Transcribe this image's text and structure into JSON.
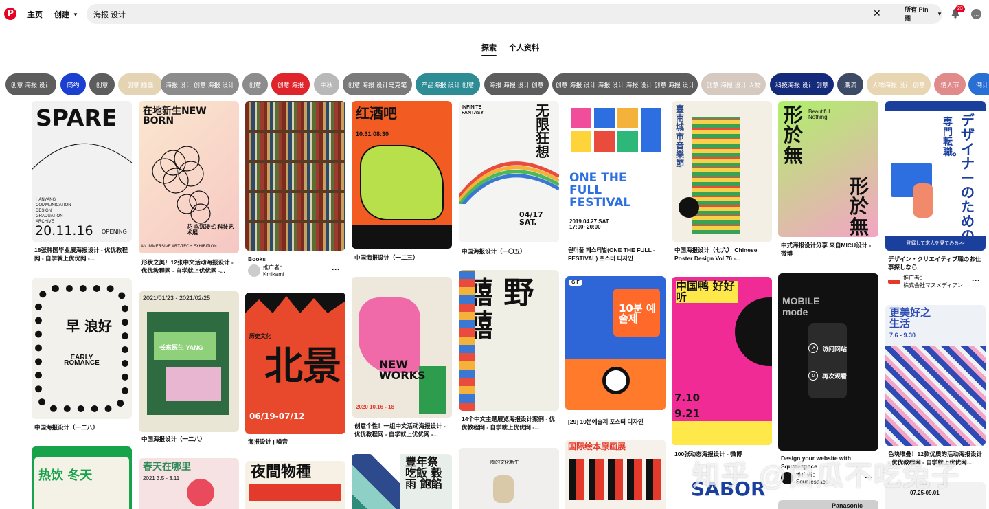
{
  "header": {
    "logo": "P",
    "home": "主页",
    "create": "创建",
    "search_value": "海报 设计",
    "clear_icon": "✕",
    "scope": "所有 Pin 图",
    "notifications_count": "23",
    "chat_icon": "…"
  },
  "tabs": [
    {
      "label": "探索",
      "active": true
    },
    {
      "label": "个人资料",
      "active": false
    }
  ],
  "chips": [
    {
      "label": "创意 海报 设计",
      "color": "#5d5d5d"
    },
    {
      "label": "简约",
      "color": "#1a3fd1"
    },
    {
      "label": "创意",
      "color": "#5d5d5d"
    },
    {
      "label": "创意 插画",
      "color": "#e4d4b4"
    },
    {
      "label": "海报 设计 创意 海报 设计",
      "color": "#8c8c8c"
    },
    {
      "label": "创意",
      "color": "#8c8c8c"
    },
    {
      "label": "创意 海报",
      "color": "#e0242b"
    },
    {
      "label": "中秋",
      "color": "#b8b8b8"
    },
    {
      "label": "创意 海报 设计马克笔",
      "color": "#7a7a7a"
    },
    {
      "label": "产品海报 设计 创意",
      "color": "#2e8c95"
    },
    {
      "label": "海报 海报 设计 创意",
      "color": "#5d5d5d"
    },
    {
      "label": "创意 海报 设计 海报 设计 海报 设计 创意 海报 设计",
      "color": "#5d5d5d"
    },
    {
      "label": "创意 海报 设计 人物",
      "color": "#d6c9c0"
    },
    {
      "label": "科技海报 设计 创意",
      "color": "#142a7a"
    },
    {
      "label": "潮流",
      "color": "#3d4a66"
    },
    {
      "label": "人物海报 设计 创意",
      "color": "#e8d6b2"
    },
    {
      "label": "情人节",
      "color": "#e08a8a"
    },
    {
      "label": "倒计",
      "color": "#2a6fd4"
    }
  ],
  "pins": {
    "p1": {
      "big": "SPARE",
      "sub": "HANYANG COMMUNICATION DESIGN GRADUATION ARCHIVE",
      "date": "20.11.16",
      "tag": "OPENING",
      "caption": "18张韩国毕业展海报设计 - 优优教程网 - 自学就上优优网 -..."
    },
    "p2": {
      "big": "在地新生NEW BORN",
      "sub": "AN IMMERSIVE ART-TECH EXHIBITION",
      "cn": "花 鸟沉浸式 科技艺术展",
      "caption": "形状之美！12张中文活动海报设计 - 优优教程网 - 自学就上优优网 -..."
    },
    "p3": {
      "caption": "Books",
      "promoted": "推广者：",
      "user": "Kmikami"
    },
    "p4": {
      "big": "红酒吧",
      "sub": "10.31  08:30",
      "caption": "中国海报设计（一二三）"
    },
    "p5": {
      "big": "无限狂想",
      "sub": "INFINITE FANTASY",
      "date": "04/17 SAT.",
      "caption": "中国海报设计（一〇五）"
    },
    "p6": {
      "big": "ONE THE FULL FESTIVAL",
      "date": "2019.04.27 SAT 17:00~20:00",
      "caption": "원더풀 페스티벌(ONE THE FULL - FESTIVAL) 포스터 디자인"
    },
    "p7": {
      "big": "臺南城市音樂節",
      "caption": "中国海报设计（七六） Chinese Poster Design Vol.76 -..."
    },
    "p8": {
      "big": "形於無",
      "sub": "Beautiful Nothing",
      "caption": "中式海报设计分享 来自MICU设计 - 微博"
    },
    "p9": {
      "big": "デザイナーのための",
      "sub": "専門転職。",
      "cta": "登録して求人を見てみる>>",
      "caption": "デザイン・クリエイティブ職のお仕事探しなら",
      "promoted": "推广者：",
      "user": "株式会社マスメディアン"
    },
    "p10": {
      "big": "早 浪好",
      "sub": "EARLY ROMANCE",
      "caption": "中国海报设计（一二八）"
    },
    "p11": {
      "big": "2021/01/23 - 2021/02/25",
      "sub": "长东医生 YANG",
      "caption": "中国海报设计（一二八）"
    },
    "p12": {
      "big": "北景",
      "sub": "历史文化",
      "date": "06/19-07/12",
      "caption": "海报设计 | 噪音"
    },
    "p13": {
      "big": "NEW WORKS",
      "date": "2020 10.16 - 18",
      "caption": "创意个性！一组中文活动海报设计 - 优优教程网 - 自学就上优优网 -..."
    },
    "p14": {
      "big": "囍 野 囍",
      "caption": "14个中文主题展览海报设计案例 - 优优教程网 - 自学就上优优网 -..."
    },
    "p15": {
      "big": "10분 예술제",
      "gif": "GIF",
      "caption": "[29] 10분예술제 포스터 디자인"
    },
    "p16": {
      "big": "中国鸭 好好听",
      "date": "7.10 9.21",
      "caption": "100张动态海报设计 - 微博"
    },
    "p17": {
      "sub": "MOBILE mode",
      "visit": "访问网站",
      "replay": "再次观看",
      "caption": "Design your website with Squarespace",
      "promoted": "推广者：",
      "user": "Squarespace"
    },
    "p18": {
      "big": "更美好之生活",
      "date": "7.6 - 9.30",
      "caption": "色块堆叠！12款优质的活动海报设计 - 优优教程网 - 自学就上优优网..."
    },
    "p19": {
      "big": "热饮 冬天",
      "caption": ""
    },
    "p20": {
      "big": "春天在哪里",
      "date": "2021 3.5 - 3.11",
      "caption": ""
    },
    "p21": {
      "big": "夜間物種",
      "caption": ""
    },
    "p22": {
      "big": "豐年祭 吃飯 穀雨 飽餡",
      "caption": ""
    },
    "p23": {
      "big": "陶的文化新生",
      "caption": ""
    },
    "p24": {
      "big": "国际绘本原画展",
      "caption": ""
    },
    "p25": {
      "big": "SABOR",
      "caption": ""
    },
    "p26": {
      "big": "Panasonic",
      "caption": ""
    },
    "p27": {
      "date": "07.25-09.01",
      "caption": ""
    }
  },
  "watermark": "知乎 @白瓜不吃兔子"
}
